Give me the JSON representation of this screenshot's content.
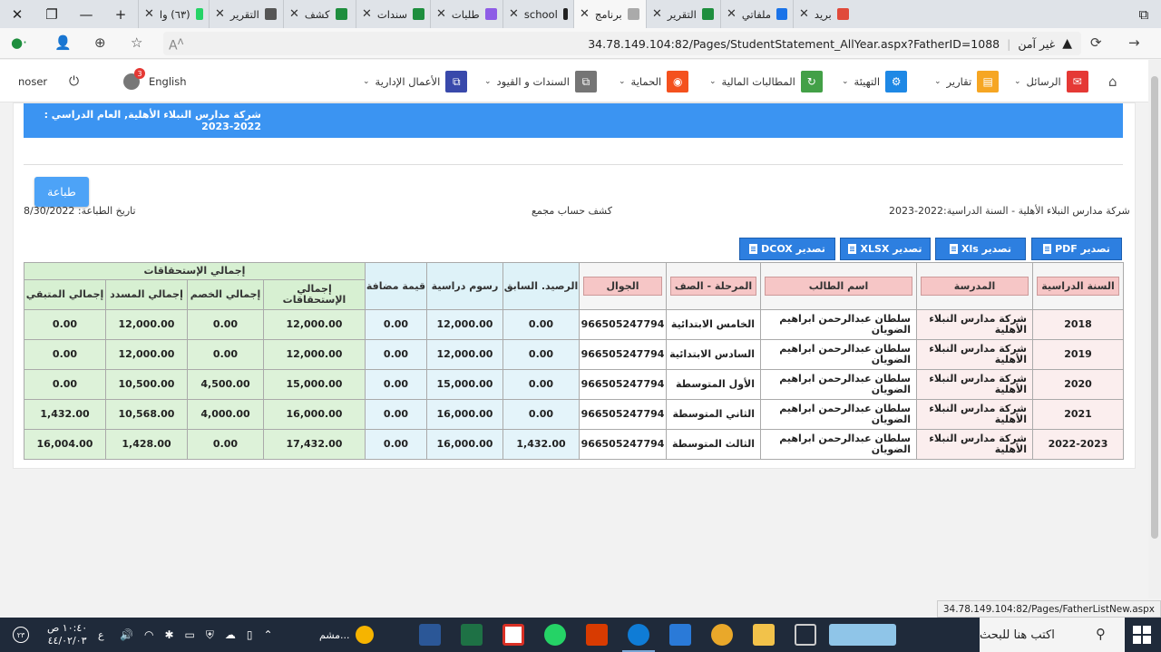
{
  "browser": {
    "tabs": [
      {
        "label": "بريد",
        "color": "#e04a3a"
      },
      {
        "label": "ملفاتي",
        "color": "#1a73e8"
      },
      {
        "label": "التقرير",
        "color": "#1e8e3e"
      },
      {
        "label": "برنامج",
        "color": "#aaaaaa"
      },
      {
        "label": "school",
        "color": "#222222"
      },
      {
        "label": "طلبات",
        "color": "#8e5ce6"
      },
      {
        "label": "سندات",
        "color": "#1e8e3e"
      },
      {
        "label": "كشف",
        "color": "#1e8e3e"
      },
      {
        "label": "التقرير",
        "color": "#555555"
      },
      {
        "label": "(٦٣) وا",
        "color": "#25d366"
      }
    ],
    "url": "34.78.149.104:82/Pages/StudentStatement_AllYear.aspx?FatherID=1088",
    "security_label": "غير آمن",
    "status_url": "34.78.149.104:82/Pages/FatherListNew.aspx"
  },
  "nav": {
    "home_icon": "home-icon",
    "items": [
      {
        "label": "الرسائل",
        "color": "#e53935"
      },
      {
        "label": "تقارير",
        "color": "#f6a623"
      },
      {
        "label": "التهيئة",
        "color": "#1e88e5"
      },
      {
        "label": "المطالبات المالية",
        "color": "#43a047"
      },
      {
        "label": "الحماية",
        "color": "#f4511e"
      },
      {
        "label": "السندات و القيود",
        "color": "#757575"
      },
      {
        "label": "الأعمال الإدارية",
        "color": "#3949ab"
      }
    ],
    "language": "English",
    "notification_count": "3",
    "user": "noser"
  },
  "banner": "شركة مدارس النبلاء الأهلية, العام الدراسي : 2022-2023",
  "print_button": "طباعة",
  "print_date": "تاريخ الطباعة: 8/30/2022",
  "report_title": "كشف حساب مجمع",
  "company_year": "شركة مدارس النبلاء الأهلية - السنة الدراسية:2022-2023",
  "exports": [
    "تصدير PDF",
    "تصدير Xls",
    "تصدير XLSX",
    "تصدير DCOX"
  ],
  "table": {
    "headers": {
      "year": "السنة الدراسية",
      "school": "المدرسة",
      "student": "اسم الطالب",
      "grade": "المرحلة - الصف",
      "mobile": "الجوال",
      "prev_balance": "الرصيد. السابق",
      "fees": "رسوم دراسية",
      "added_value": "قيمة مضافة",
      "dues_group": "إجمالي الإستحقاقات",
      "total_dues": "إجمالي الإستحقاقات",
      "total_discount": "إجمالي الخصم",
      "total_paid": "إجمالي المسدد",
      "total_remaining": "إجمالي المتبقي"
    },
    "rows": [
      {
        "year": "2018",
        "school": "شركة مدارس النبلاء الأهلية",
        "student": "سلطان عبدالرحمن ابراهيم الضويان",
        "grade": "الخامس الابتدائية",
        "mobile": "966505247794",
        "prev": "0.00",
        "fees": "12,000.00",
        "vat": "0.00",
        "dues": "12,000.00",
        "discount": "0.00",
        "paid": "12,000.00",
        "remaining": "0.00"
      },
      {
        "year": "2019",
        "school": "شركة مدارس النبلاء الأهلية",
        "student": "سلطان عبدالرحمن ابراهيم الضويان",
        "grade": "السادس الابتدائية",
        "mobile": "966505247794",
        "prev": "0.00",
        "fees": "12,000.00",
        "vat": "0.00",
        "dues": "12,000.00",
        "discount": "0.00",
        "paid": "12,000.00",
        "remaining": "0.00"
      },
      {
        "year": "2020",
        "school": "شركة مدارس النبلاء الأهلية",
        "student": "سلطان عبدالرحمن ابراهيم الضويان",
        "grade": "الأول المتوسطة",
        "mobile": "966505247794",
        "prev": "0.00",
        "fees": "15,000.00",
        "vat": "0.00",
        "dues": "15,000.00",
        "discount": "4,500.00",
        "paid": "10,500.00",
        "remaining": "0.00"
      },
      {
        "year": "2021",
        "school": "شركة مدارس النبلاء الأهلية",
        "student": "سلطان عبدالرحمن ابراهيم الضويان",
        "grade": "الثاني المتوسطة",
        "mobile": "966505247794",
        "prev": "0.00",
        "fees": "16,000.00",
        "vat": "0.00",
        "dues": "16,000.00",
        "discount": "4,000.00",
        "paid": "10,568.00",
        "remaining": "1,432.00"
      },
      {
        "year": "2022-2023",
        "school": "شركة مدارس النبلاء الأهلية",
        "student": "سلطان عبدالرحمن ابراهيم الضويان",
        "grade": "الثالث المتوسطة",
        "mobile": "966505247794",
        "prev": "1,432.00",
        "fees": "16,000.00",
        "vat": "0.00",
        "dues": "17,432.00",
        "discount": "0.00",
        "paid": "1,428.00",
        "remaining": "16,004.00"
      }
    ]
  },
  "taskbar": {
    "search_placeholder": "اكتب هنا للبحث",
    "weather_text": "مشم...",
    "time": "١٠:٤٠ ص",
    "date": "٤٤/٠٢/٠٣",
    "lang": "ع",
    "notif_badge": "٢٣"
  }
}
